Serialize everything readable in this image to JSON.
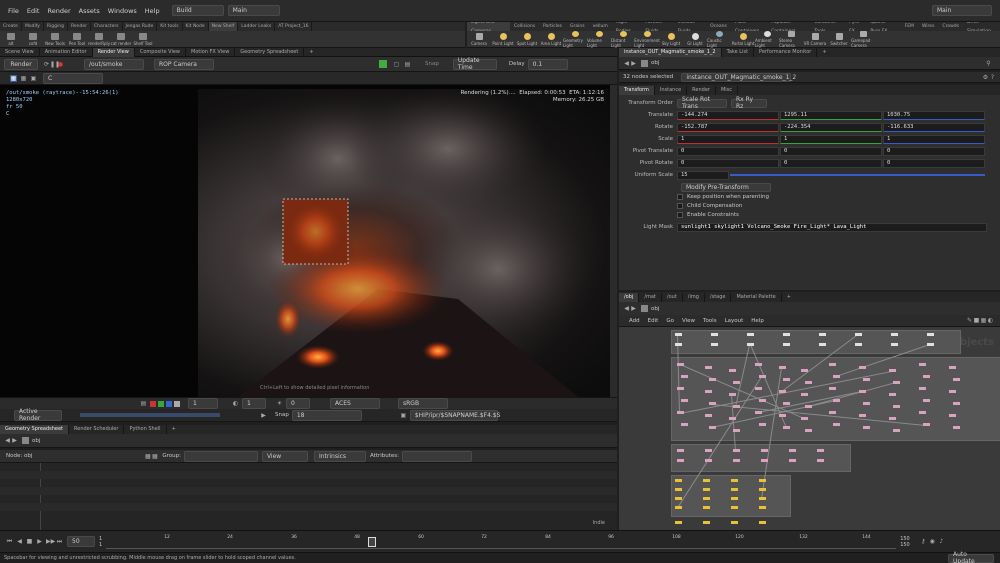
{
  "menu": {
    "items": [
      "File",
      "Edit",
      "Render",
      "Assets",
      "Windows",
      "Help"
    ],
    "desktop": "Build",
    "desktop2": "Main",
    "right_desktop": "Main"
  },
  "shelf": {
    "tabs": [
      "Create",
      "Modify",
      "Rigging",
      "Render",
      "Characters",
      "Jengas Rude",
      "Kit tools",
      "Kit Node",
      "New Shelf",
      "Ladder Leaks",
      "AT Project_16"
    ],
    "tools": [
      "alt",
      "cofd",
      "New Tools",
      "Pen Tool",
      "renderRply",
      "cat render",
      "Shelf Tool"
    ]
  },
  "lights": {
    "tabs": [
      "Lights and Cameras",
      "Collisions",
      "Particles",
      "Grains",
      "vellum",
      "Rigid Bodies",
      "Particle Fluids",
      "Viscous Fluids",
      "Oceans",
      "Fluid Containers",
      "Populate Containers",
      "Container Tools",
      "Pyro FX",
      "Sparse Pyro FX",
      "FEM",
      "Wires",
      "Crowds",
      "Drive Simulation"
    ],
    "tools": [
      "Camera",
      "Point Light",
      "Spot Light",
      "Area Light",
      "Geometry Light",
      "Volume Light",
      "Distant Light",
      "Environment Light",
      "Sky Light",
      "GI Light",
      "Caustic Light",
      "Portal Light",
      "Ambient Light",
      "Stereo Camera",
      "VR Camera",
      "Switcher",
      "Gamepad Camera"
    ]
  },
  "left_tabs": [
    "Scene View",
    "Animation Editor",
    "Render View",
    "Composite View",
    "Motion FX View",
    "Geometry Spreadsheet"
  ],
  "left_tabs_active": 2,
  "render_view": {
    "render_button": "Render",
    "rop_path": "/out/smoke",
    "camera": "ROP Camera",
    "snap": "Snap",
    "update": "Update Time",
    "delay_label": "Delay",
    "delay_value": "0.1",
    "snapshot": "C",
    "info_line1": "/out/smoke (raytrace)--15:54:26(1)",
    "info_line2": "1280x720",
    "info_line3": "fr 50",
    "info_line4": "C",
    "stat_line1": "Rendering (1.2%)....",
    "stat_elapsed": "Elapsed: 0:00:53",
    "stat_eta": "ETA: 1:12:16",
    "stat_memory": "Memory:",
    "stat_mem_value": "26.25 GB",
    "hint": "Ctrl+Left to show detailed pixel information",
    "bottom": {
      "frame": "1",
      "gamma": "1",
      "exposure": "0",
      "lut": "ACES",
      "space": "sRGB"
    },
    "active_render": "Active Render",
    "snap2": "Snap",
    "snap2_value": "18",
    "ship_path": "$HIP/ipr/$SNAPNAME.$F4.$S"
  },
  "geo_tabs": [
    "Geometry Spreadsheet",
    "Render Scheduler",
    "Python Shell"
  ],
  "geo": {
    "path": "obj",
    "node": "Node: obj",
    "group": "Group:",
    "view": "View",
    "intrinsics": "Intrinsics",
    "attributes": "Attributes:",
    "state": "Indie"
  },
  "timeline": {
    "frame": "50",
    "start": "1",
    "start2": "1",
    "ticks": [
      "12",
      "24",
      "36",
      "48",
      "60",
      "72",
      "84",
      "96",
      "108",
      "120",
      "132",
      "144"
    ],
    "end": "150",
    "end2": "150",
    "auto_update": "Auto Update"
  },
  "status": "Spacebar for viewing and unrestricted scrubbing. Middle mouse drag on frame slider to hold scoped channel values.",
  "right_tabs": [
    "instance_OUT_Magmatic_smoke_1_2",
    "Take List",
    "Performance Monitor"
  ],
  "param": {
    "path": "obj",
    "selected": "32 nodes selected",
    "node_name": "instance_OUT_Magmatic_smoke_1_2",
    "tabs": [
      "Transform",
      "Instance",
      "Render",
      "Misc"
    ],
    "transform_order_label": "Transform Order",
    "transform_order": "Scale Rot Trans",
    "rot_order": "Rx Ry Rz",
    "translate_label": "Translate",
    "translate": [
      "-144.274",
      "1295.11",
      "1030.75"
    ],
    "rotate_label": "Rotate",
    "rotate": [
      "-152.787",
      "-224.354",
      "-116.633"
    ],
    "scale_label": "Scale",
    "scale": [
      "1",
      "1",
      "1"
    ],
    "pivot_translate_label": "Pivot Translate",
    "pivot_translate": [
      "0",
      "0",
      "0"
    ],
    "pivot_rotate_label": "Pivot Rotate",
    "pivot_rotate": [
      "0",
      "0",
      "0"
    ],
    "uniform_scale_label": "Uniform Scale",
    "uniform_scale": "15",
    "modify_pre": "Modify Pre-Transform",
    "keep_position": "Keep position when parenting",
    "child_comp": "Child Compensation",
    "enable_constraints": "Enable Constraints",
    "light_mask_label": "Light Mask",
    "light_mask": "sunlight1  skylight1 Volcano_Smoke Fire_Light*  Lava_Light"
  },
  "net_tabs": [
    "/obj",
    "/mat",
    "/out",
    "/img",
    "/stage",
    "Material Palette"
  ],
  "net": {
    "path": "obj",
    "menu": [
      "Add",
      "Edit",
      "Go",
      "View",
      "Tools",
      "Layout",
      "Help"
    ],
    "watermark": "Objects"
  },
  "colors": {
    "node_pink": "#d9a2c0",
    "node_yellow": "#e8c230",
    "accent_blue": "#3a5ac8"
  }
}
